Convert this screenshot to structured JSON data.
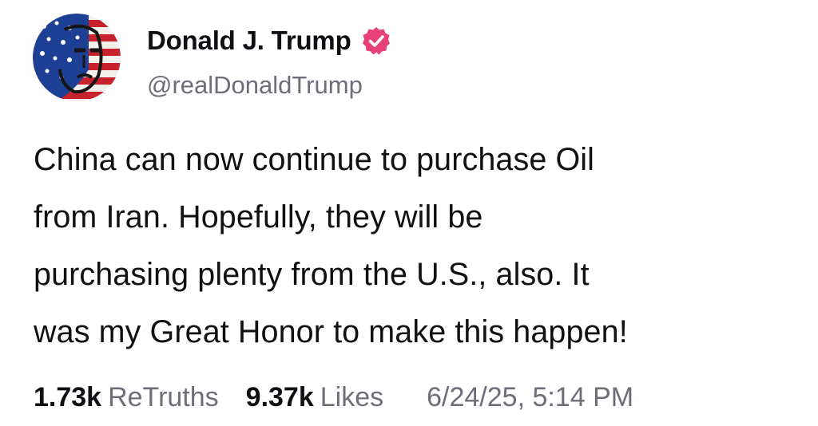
{
  "author": {
    "display_name": "Donald J. Trump",
    "handle": "@realDonaldTrump",
    "verified_icon": "verified-badge-icon",
    "avatar_icon": "flag-portrait-avatar"
  },
  "post": {
    "lines": [
      "China can now continue to purchase Oil",
      "from Iran. Hopefully, they will be",
      "purchasing plenty from the U.S., also. It",
      "was my Great Honor to make this happen!"
    ]
  },
  "stats": {
    "retruths_count": "1.73k",
    "retruths_label": "ReTruths",
    "likes_count": "9.37k",
    "likes_label": "Likes",
    "timestamp": "6/24/25, 5:14 PM"
  },
  "colors": {
    "verified": "#e8417a",
    "text_primary": "#111111",
    "text_secondary": "#6e6e78"
  }
}
